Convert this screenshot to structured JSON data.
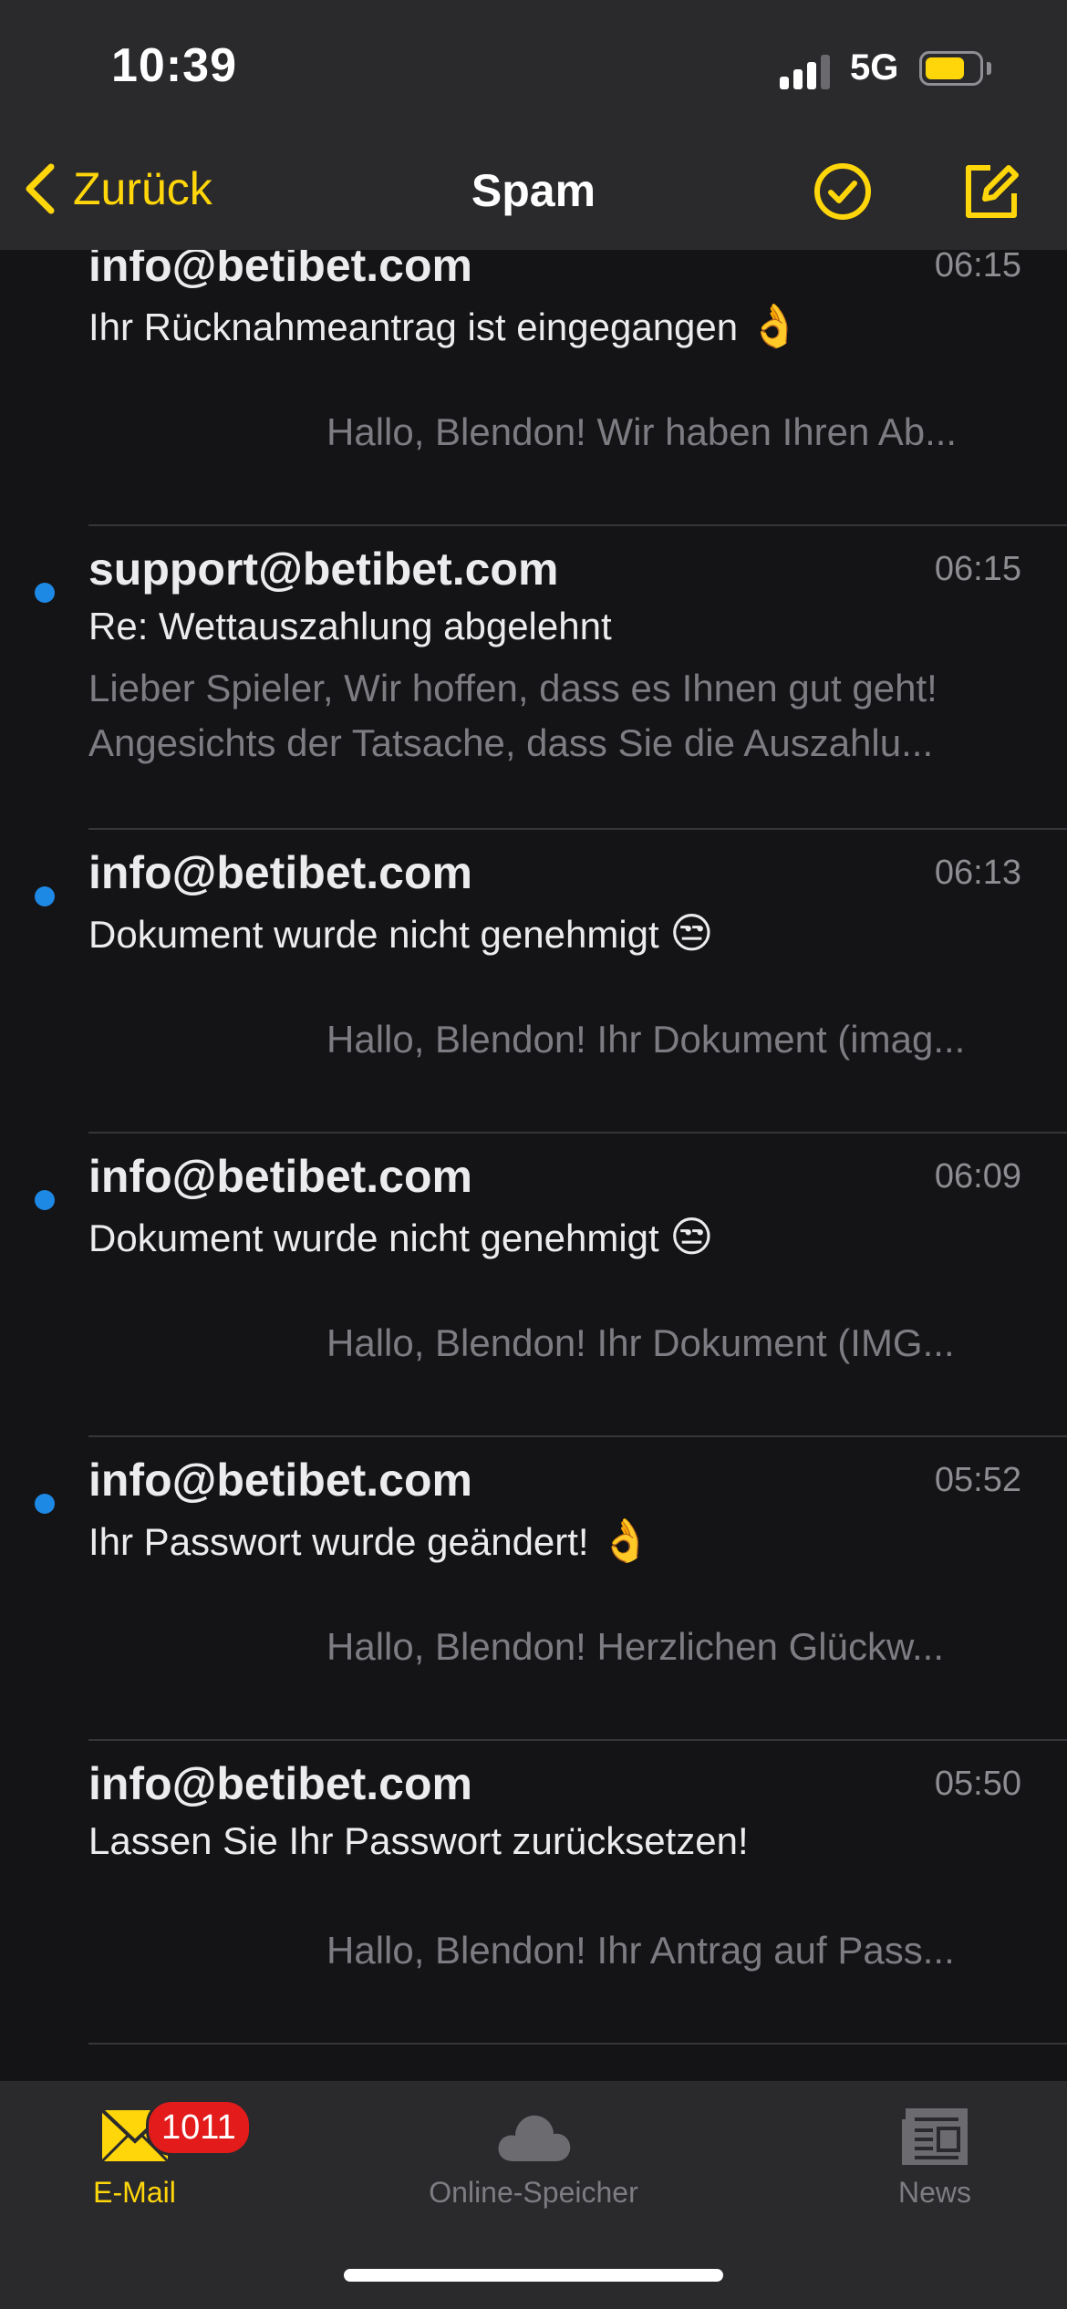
{
  "status_bar": {
    "time": "10:39",
    "network": "5G",
    "signal_bars_active": 3,
    "signal_bars_total": 4,
    "battery_level_fraction": 0.75
  },
  "nav": {
    "back_label": "Zurück",
    "title": "Spam",
    "icons": [
      "select-circle-check-icon",
      "compose-icon"
    ]
  },
  "colors": {
    "accent": "#ffd60a",
    "unread_dot": "#1e88e5",
    "badge": "#e31b1b",
    "background": "#141416",
    "bar_background": "#2a2a2d"
  },
  "messages": [
    {
      "sender": "info@betibet.com",
      "time": "06:15",
      "subject": "Ihr Rücknahmeantrag ist eingegangen",
      "emoji": "👌",
      "preview": "Hallo, Blendon! Wir haben Ihren Ab...",
      "unread": false
    },
    {
      "sender": "support@betibet.com",
      "time": "06:15",
      "subject": "Re: Wettauszahlung abgelehnt",
      "preview_line1": "Lieber Spieler, Wir hoffen, dass es Ihnen gut geht!",
      "preview_line2": "Angesichts der Tatsache, dass Sie die Auszahlu...",
      "unread": true
    },
    {
      "sender": "info@betibet.com",
      "time": "06:13",
      "subject": "Dokument wurde nicht genehmigt",
      "emoji": "😒",
      "preview": "Hallo, Blendon! Ihr Dokument (imag...",
      "unread": true
    },
    {
      "sender": "info@betibet.com",
      "time": "06:09",
      "subject": "Dokument wurde nicht genehmigt",
      "emoji": "😒",
      "preview": "Hallo, Blendon! Ihr Dokument (IMG...",
      "unread": true
    },
    {
      "sender": "info@betibet.com",
      "time": "05:52",
      "subject": "Ihr Passwort wurde geändert!",
      "emoji": "👌",
      "preview": "Hallo, Blendon! Herzlichen Glückw...",
      "unread": true
    },
    {
      "sender": "info@betibet.com",
      "time": "05:50",
      "subject": "Lassen Sie Ihr Passwort zurücksetzen!",
      "preview": "Hallo, Blendon! Ihr Antrag auf Pass...",
      "unread": false
    }
  ],
  "tabs": [
    {
      "label": "E-Mail",
      "icon": "mail-envelope-icon",
      "badge": "1011",
      "active": true
    },
    {
      "label": "Online-Speicher",
      "icon": "cloud-icon",
      "active": false
    },
    {
      "label": "News",
      "icon": "newspaper-icon",
      "active": false
    }
  ]
}
